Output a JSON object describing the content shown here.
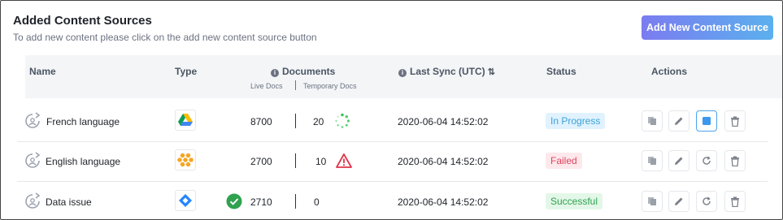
{
  "header": {
    "title": "Added Content Sources",
    "subtitle": "To add new content please click on the add new content source button",
    "add_button": "Add New Content Source"
  },
  "table": {
    "columns": {
      "name": "Name",
      "type": "Type",
      "documents": "Documents",
      "live_docs": "Live Docs",
      "temporary_docs": "Temporary Docs",
      "last_sync": "Last Sync (UTC)",
      "status": "Status",
      "actions": "Actions"
    },
    "rows": [
      {
        "name": "French language",
        "type_icon": "google-drive-icon",
        "live_docs": "8700",
        "temporary_docs": "20",
        "doc_status_icon": "loading-spinner-icon",
        "last_sync": "2020-06-04 14:52:02",
        "status": "In Progress",
        "status_color": "#3aa3d8"
      },
      {
        "name": "English language",
        "type_icon": "mailchimp-honeycomb-icon",
        "live_docs": "2700",
        "temporary_docs": "10",
        "doc_status_icon": "warning-triangle-icon",
        "last_sync": "2020-06-04 14:52:02",
        "status": "Failed",
        "status_color": "#e0445d"
      },
      {
        "name": "Data issue",
        "type_icon": "jira-icon",
        "live_docs": "2710",
        "temporary_docs": "0",
        "doc_status_icon": "success-check-icon",
        "last_sync": "2020-06-04 14:52:02",
        "status": "Successful",
        "status_color": "#2fa24f"
      }
    ]
  },
  "colors": {
    "accent_start": "#7b7cf0",
    "accent_end": "#5bb0ee",
    "header_bg": "#f3f5f7"
  }
}
